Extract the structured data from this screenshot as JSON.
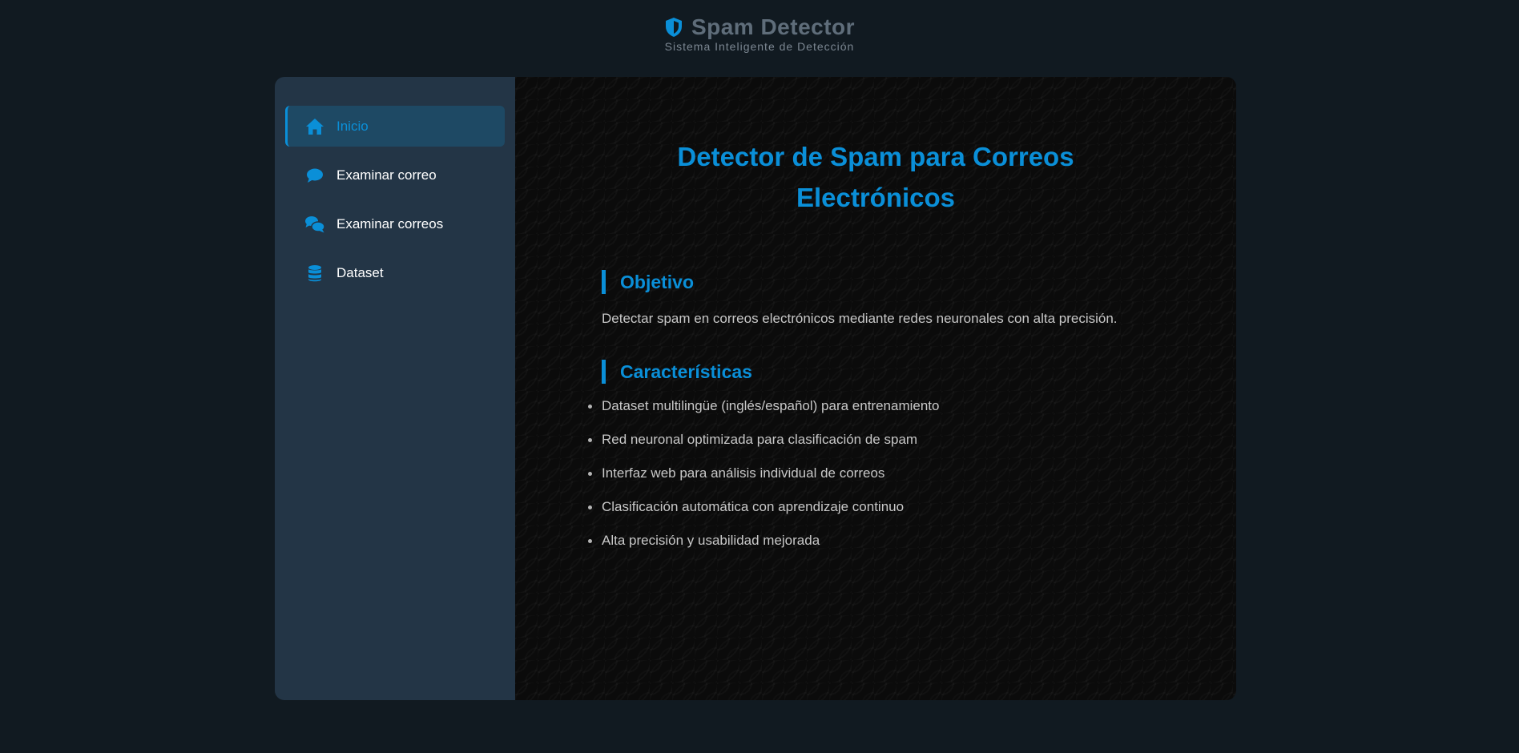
{
  "header": {
    "title": "Spam Detector",
    "subtitle": "Sistema Inteligente de Detección",
    "icon": "shield-icon"
  },
  "colors": {
    "accent": "#0a8fd8",
    "sidebar_bg": "#233546",
    "active_bg": "#1e4964",
    "page_bg": "#111a21"
  },
  "sidebar": {
    "items": [
      {
        "label": "Inicio",
        "icon": "home-icon",
        "active": true
      },
      {
        "label": "Examinar correo",
        "icon": "comment-icon",
        "active": false
      },
      {
        "label": "Examinar correos",
        "icon": "comments-icon",
        "active": false
      },
      {
        "label": "Dataset",
        "icon": "database-icon",
        "active": false
      }
    ]
  },
  "main": {
    "title_line1": "Detector de Spam para Correos",
    "title_line2": "Electrónicos",
    "objective": {
      "heading": "Objetivo",
      "text": "Detectar spam en correos electrónicos mediante redes neuronales con alta precisión."
    },
    "features": {
      "heading": "Características",
      "items": [
        "Dataset multilingüe (inglés/español) para entrenamiento",
        "Red neuronal optimizada para clasificación de spam",
        "Interfaz web para análisis individual de correos",
        "Clasificación automática con aprendizaje continuo",
        "Alta precisión y usabilidad mejorada"
      ]
    }
  }
}
